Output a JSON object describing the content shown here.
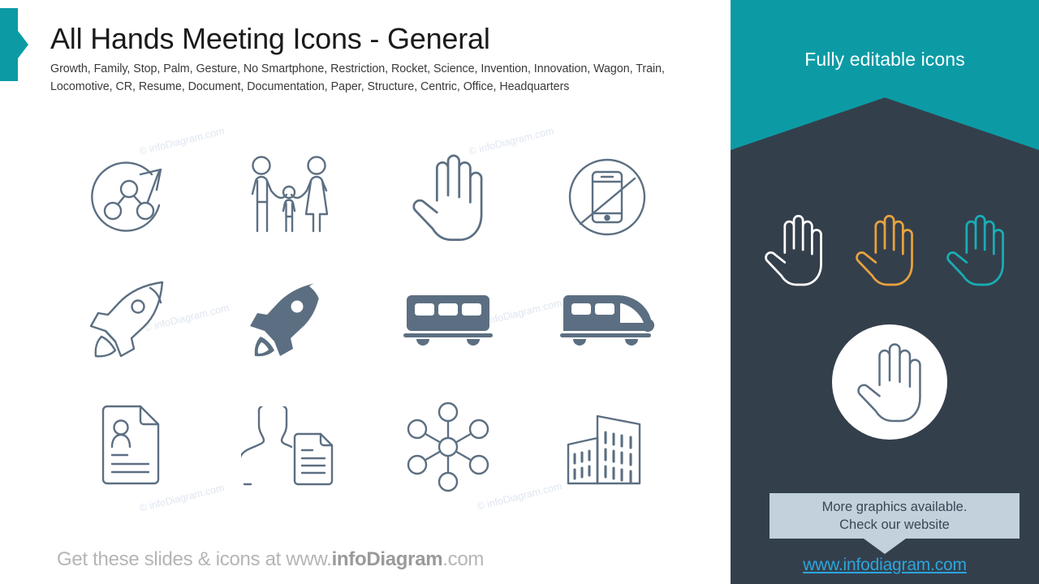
{
  "slide": {
    "title": "All Hands Meeting Icons - General",
    "subtitle": "Growth, Family, Stop, Palm, Gesture, No Smartphone, Restriction, Rocket, Science, Invention, Innovation, Wagon, Train, Locomotive, CR, Resume, Document, Documentation, Paper, Structure, Centric, Office, Headquarters",
    "footer_prefix": "Get these slides & icons at www.",
    "footer_brand": "infoDiagram",
    "footer_suffix": ".com",
    "watermark": "© infoDiagram.com"
  },
  "icons": [
    {
      "name": "growth-icon",
      "label": "Growth"
    },
    {
      "name": "family-icon",
      "label": "Family"
    },
    {
      "name": "palm-hand-icon",
      "label": "Palm / Stop"
    },
    {
      "name": "no-smartphone-icon",
      "label": "No Smartphone"
    },
    {
      "name": "rocket-outline-icon",
      "label": "Rocket outline"
    },
    {
      "name": "rocket-filled-icon",
      "label": "Rocket filled"
    },
    {
      "name": "train-wagon-icon",
      "label": "Wagon"
    },
    {
      "name": "locomotive-icon",
      "label": "Locomotive"
    },
    {
      "name": "resume-document-icon",
      "label": "Resume"
    },
    {
      "name": "person-document-icon",
      "label": "Documentation"
    },
    {
      "name": "centric-structure-icon",
      "label": "Centric structure"
    },
    {
      "name": "office-buildings-icon",
      "label": "Office Headquarters"
    }
  ],
  "panel": {
    "banner_title": "Fully editable icons",
    "callout_line1": "More graphics available.",
    "callout_line2": "Check our website",
    "link": "www.infodiagram.com",
    "hand_colors": [
      "#ffffff",
      "#E8A33D",
      "#18AEB4"
    ],
    "circle_hand_color": "#5c6f82"
  },
  "colors": {
    "teal": "#0C9BA5",
    "panel_bg": "#343f4c",
    "icon_stroke": "#5c6f82",
    "callout_bg": "#c2d1dc",
    "link_blue": "#2ba6dd"
  }
}
